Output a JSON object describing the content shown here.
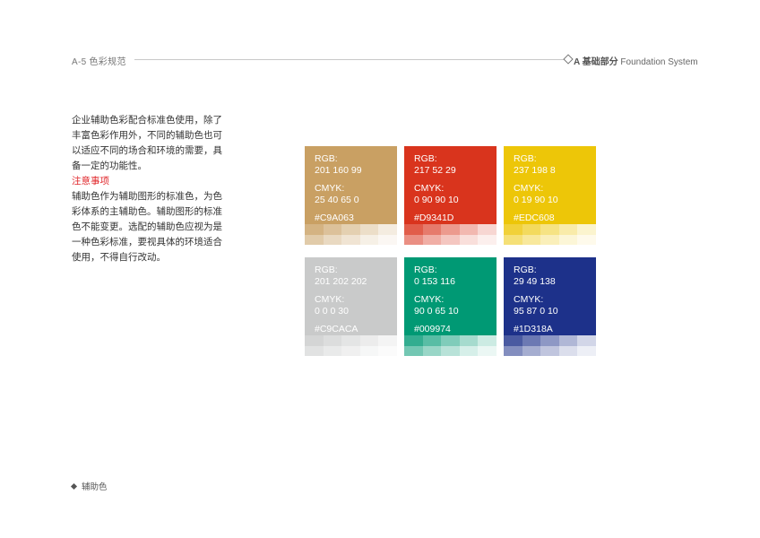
{
  "header": {
    "section": "A-5 色彩规范",
    "chapter_prefix": "A 基础部分",
    "chapter_en": "Foundation System"
  },
  "description": {
    "intro": "企业辅助色彩配合标准色使用，除了丰富色彩作用外，不同的辅助色也可以适应不同的场合和环境的需要，具备一定的功能性。",
    "note_title": "注意事项",
    "note_body": "辅助色作为辅助图形的标准色，为色彩体系的主辅助色。辅助图形的标准色不能变更。选配的辅助色应视为是一种色彩标准，要视具体的环境适合使用，不得自行改动。"
  },
  "swatches": [
    {
      "rgb_label": "RGB:",
      "rgb": "201 160 99",
      "cmyk_label": "CMYK:",
      "cmyk": "25 40 65 0",
      "hex": "#C9A063",
      "color": "#C9A063"
    },
    {
      "rgb_label": "RGB:",
      "rgb": "217 52 29",
      "cmyk_label": "CMYK:",
      "cmyk": "0 90 90 10",
      "hex": "#D9341D",
      "color": "#D9341D"
    },
    {
      "rgb_label": "RGB:",
      "rgb": "237 198 8",
      "cmyk_label": "CMYK:",
      "cmyk": "0 19 90 10",
      "hex": "#EDC608",
      "color": "#EDC608"
    },
    {
      "rgb_label": "RGB:",
      "rgb": "201 202 202",
      "cmyk_label": "CMYK:",
      "cmyk": "0 0 0 30",
      "hex": "#C9CACA",
      "color": "#C9CACA"
    },
    {
      "rgb_label": "RGB:",
      "rgb": "0 153 116",
      "cmyk_label": "CMYK:",
      "cmyk": "90 0 65 10",
      "hex": "#009974",
      "color": "#009974"
    },
    {
      "rgb_label": "RGB:",
      "rgb": "29 49 138",
      "cmyk_label": "CMYK:",
      "cmyk": "95 87 0 10",
      "hex": "#1D318A",
      "color": "#1D318A"
    }
  ],
  "footer": {
    "label": "辅助色"
  }
}
